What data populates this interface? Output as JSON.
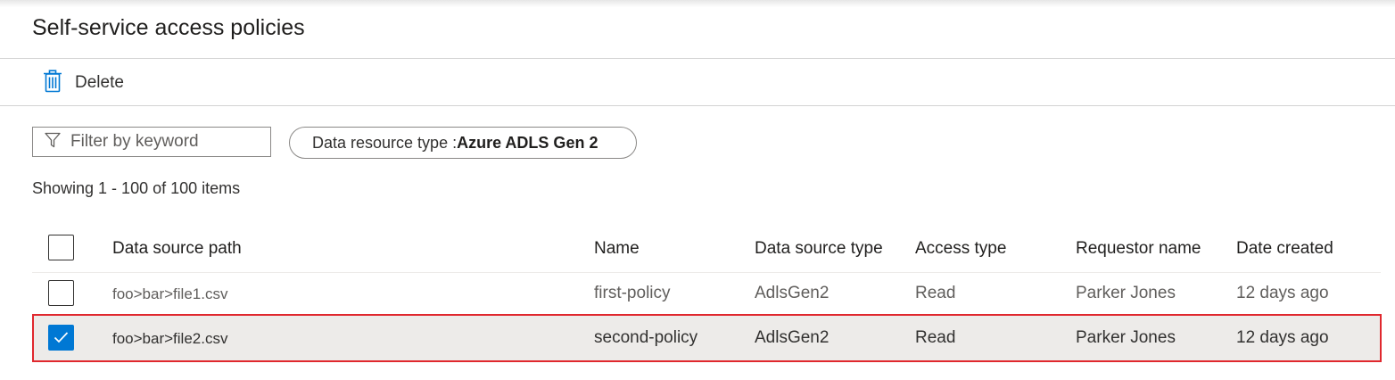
{
  "page": {
    "title": "Self-service access policies"
  },
  "toolbar": {
    "delete_label": "Delete",
    "delete_icon": "trash-icon"
  },
  "filter": {
    "placeholder": "Filter by keyword",
    "icon": "filter-icon"
  },
  "pill": {
    "label": "Data resource type : ",
    "value": "Azure ADLS Gen 2"
  },
  "status": {
    "showing": "Showing 1 - 100 of 100 items"
  },
  "table": {
    "columns": [
      "Data source path",
      "Name",
      "Data source type",
      "Access type",
      "Requestor name",
      "Date created"
    ],
    "rows": [
      {
        "path": "foo>bar>file1.csv",
        "name": "first-policy",
        "type": "AdlsGen2",
        "access": "Read",
        "requestor": "Parker Jones",
        "created": "12 days ago",
        "selected": false
      },
      {
        "path": "foo>bar>file2.csv",
        "name": "second-policy",
        "type": "AdlsGen2",
        "access": "Read",
        "requestor": "Parker Jones",
        "created": "12 days ago",
        "selected": true
      }
    ]
  },
  "colors": {
    "accent": "#0078d4",
    "highlight_border": "#e0282e",
    "selected_bg": "#edebe9"
  }
}
